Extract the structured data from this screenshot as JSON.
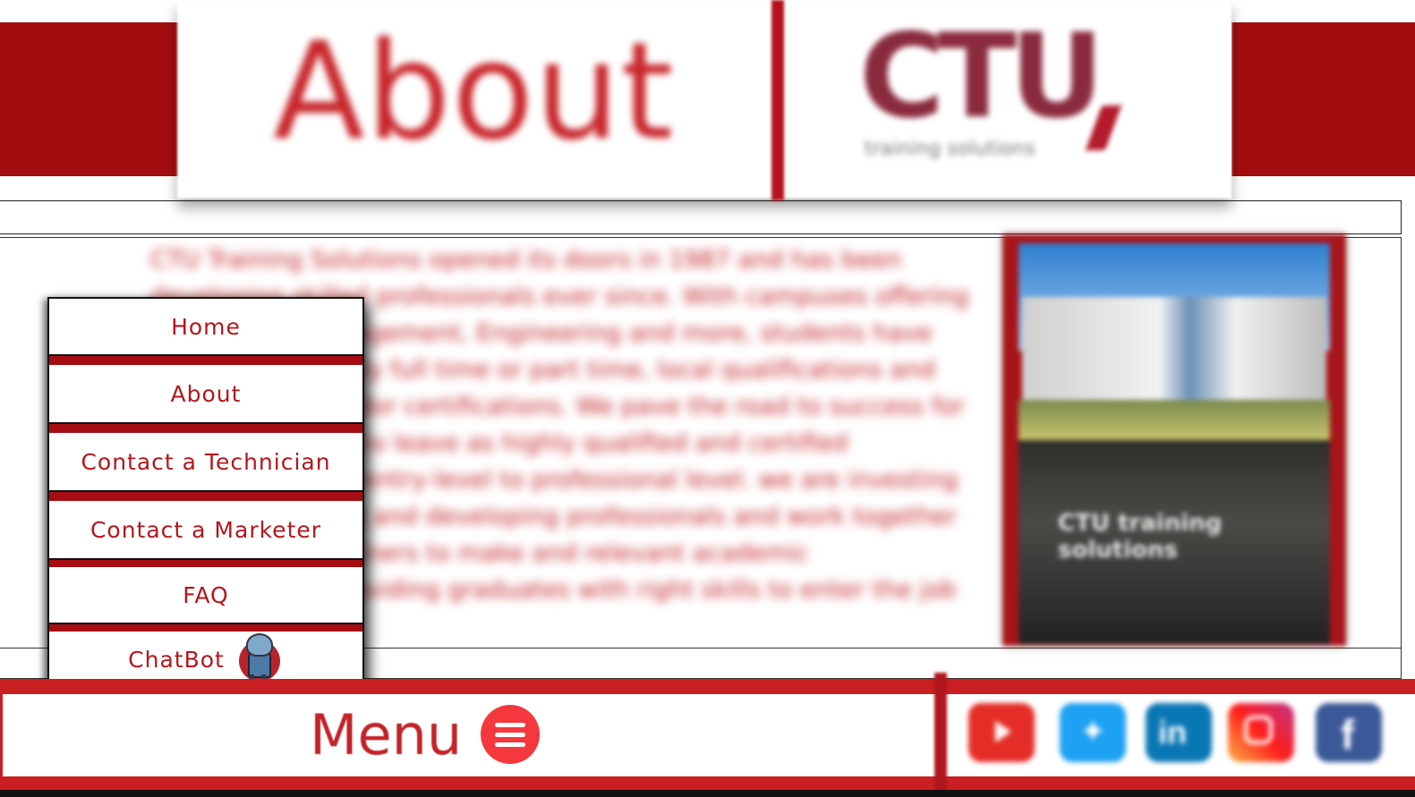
{
  "header": {
    "title": "About",
    "logo_text": "CTU",
    "logo_subtitle": "training solutions"
  },
  "main": {
    "about_paragraph": "CTU Training Solutions opened its doors in 1987 and has been developing skilled professionals ever since. With campuses offering IT, Business Management, Engineering and more, students have the choice to study full time or part time, local qualifications and international vendor certifications. We pave the road to success for our graduates, who leave as highly qualified and certified candidates, from entry-level to professional level. we are investing rapidly in training and developing professionals and work together with industry partners to make and relevant academic qualifications, providing graduates with right skills to enter the job market.",
    "photo_brand": "CTU training solutions"
  },
  "menu": {
    "items": [
      {
        "label": "Home"
      },
      {
        "label": "About"
      },
      {
        "label": "Contact a Technician"
      },
      {
        "label": "Contact a Marketer"
      },
      {
        "label": "FAQ"
      },
      {
        "label": "ChatBot",
        "icon": "robot-mascot-icon"
      }
    ]
  },
  "footer": {
    "menu_label": "Menu",
    "menu_icon": "hamburger-icon",
    "social": [
      {
        "name": "youtube-icon",
        "color": "#e52d27"
      },
      {
        "name": "twitter-icon",
        "color": "#1da1f2"
      },
      {
        "name": "linkedin-icon",
        "color": "#0a77b5"
      },
      {
        "name": "instagram-icon",
        "color": "#e1306c"
      },
      {
        "name": "facebook-icon",
        "color": "#3b5998"
      }
    ]
  },
  "colors": {
    "brand_red": "#a40d0f",
    "text_red": "#b5161c",
    "menu_button": "#f4383e"
  }
}
